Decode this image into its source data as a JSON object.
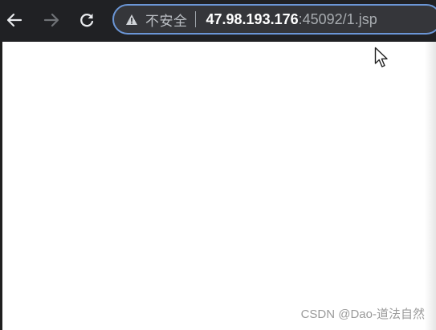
{
  "browser": {
    "nav": {
      "back_icon": "arrow-left-icon",
      "forward_icon": "arrow-right-icon",
      "reload_icon": "reload-icon"
    },
    "address_bar": {
      "security_icon": "warning-triangle-icon",
      "security_label": "不安全",
      "url_host": "47.98.193.176",
      "url_rest": ":45092/1.jsp"
    },
    "colors": {
      "toolbar": "#202124",
      "omnibox_border": "#6b96d6",
      "omnibox_bg": "#35363a"
    }
  },
  "page": {
    "cursor_icon": "mouse-pointer-icon"
  },
  "watermark": {
    "text": "CSDN @Dao-道法自然"
  }
}
